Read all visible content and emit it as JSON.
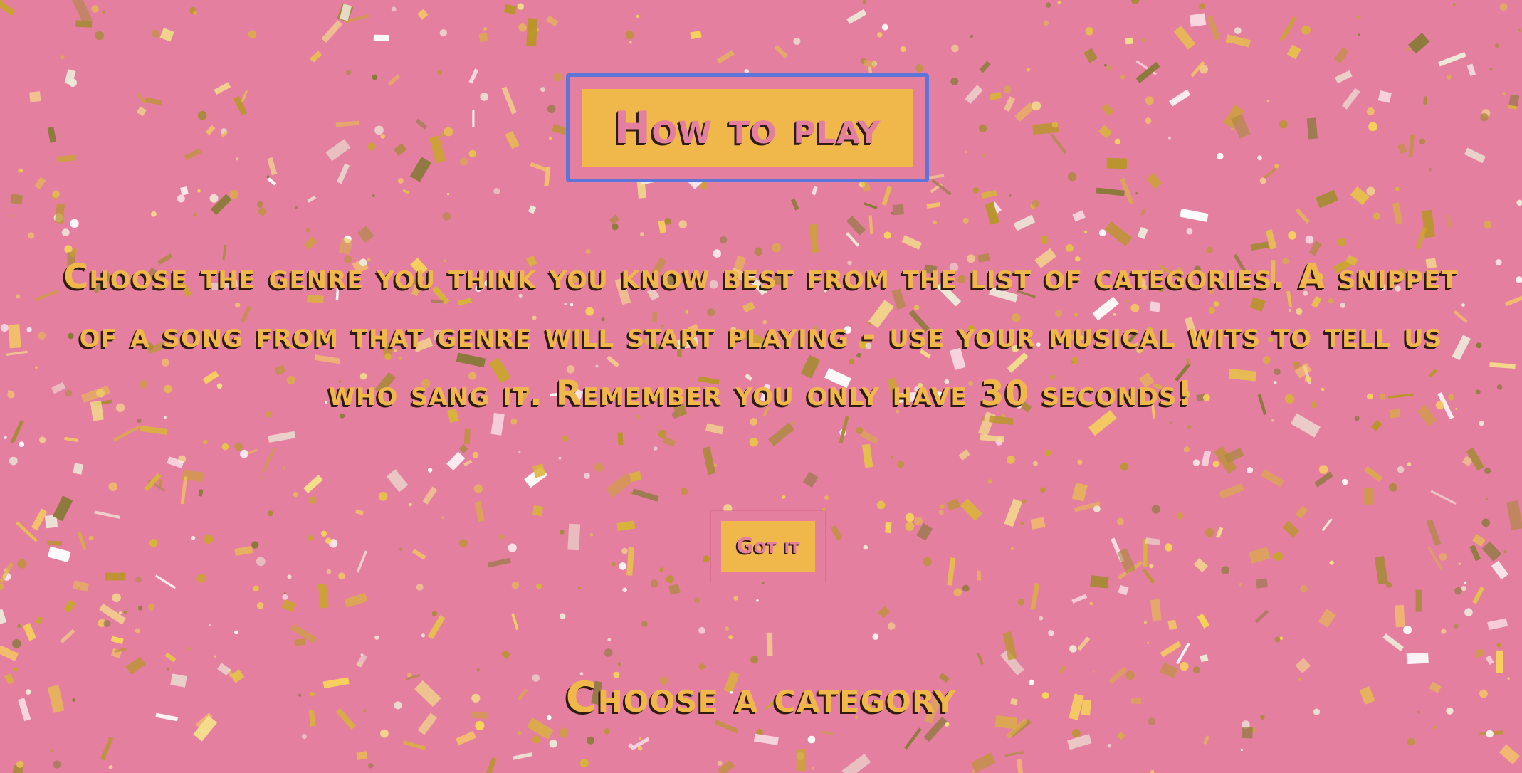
{
  "colors": {
    "background": "#e57f9f",
    "accent_gold": "#f0b84b",
    "frame_blue": "#5d74d9",
    "text_shadow": "#2d1b14"
  },
  "background": {
    "pattern": "gold-confetti"
  },
  "modal": {
    "title": "How to play",
    "instructions": "Choose the genre you think you know best from the list of categories. A snippet of a song from that genre will start playing - use your musical wits to tell us who sang it. Remember you only have 30 seconds!",
    "confirm_label": "Got it"
  },
  "categories": {
    "heading": "Choose a category"
  }
}
